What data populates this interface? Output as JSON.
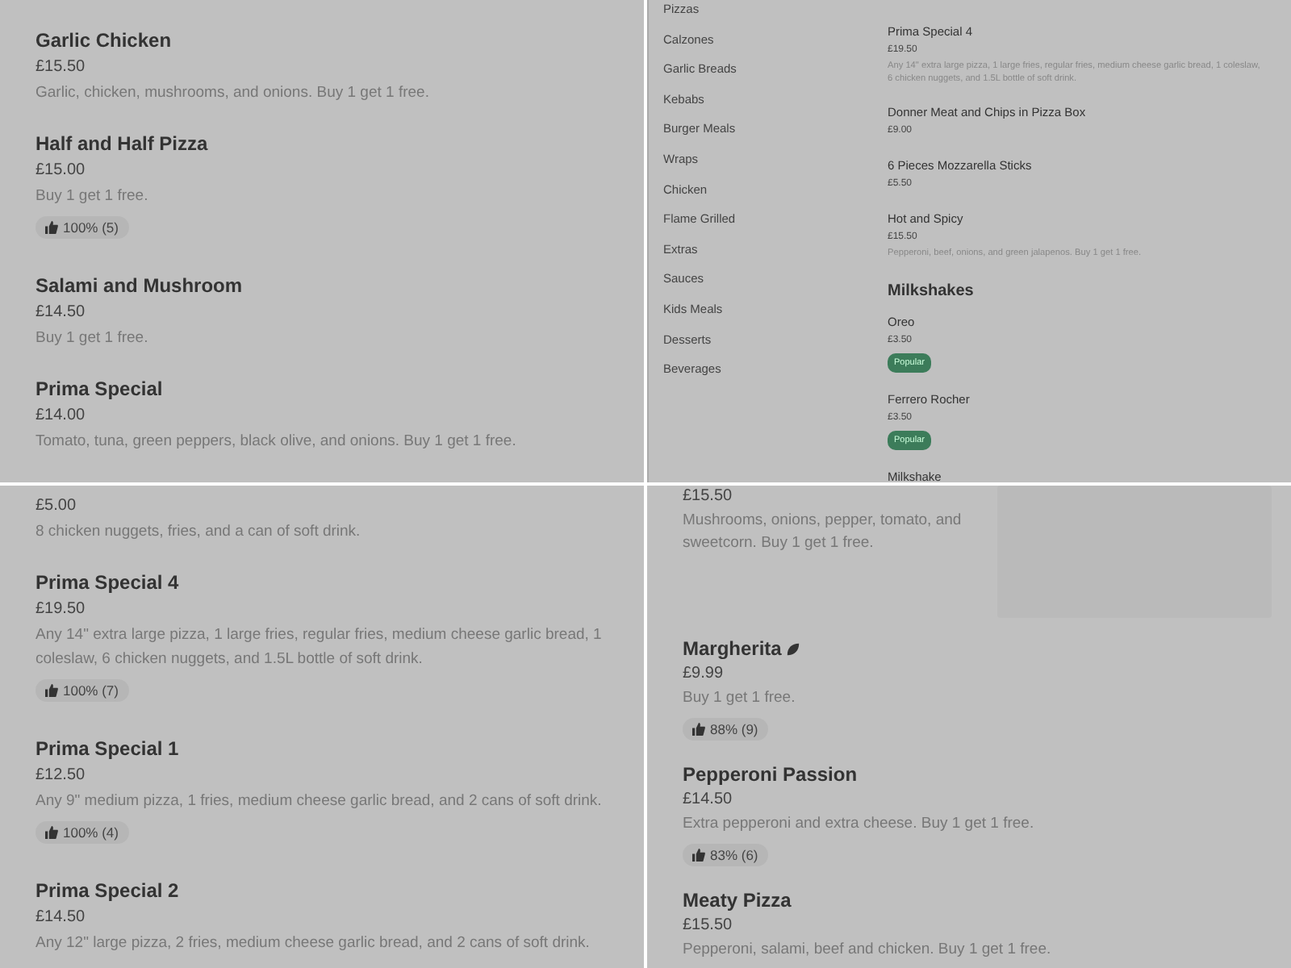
{
  "panels": [
    {
      "kind": "list",
      "items": [
        {
          "name": "Garlic Chicken",
          "price": "£15.50",
          "description": "Garlic, chicken, mushrooms, and onions. Buy 1 get 1 free."
        },
        {
          "name": "Half and Half Pizza",
          "price": "£15.00",
          "description": "Buy 1 get 1 free.",
          "rating": "100% (5)"
        },
        {
          "name": "Salami and Mushroom",
          "price": "£14.50",
          "description": "Buy 1 get 1 free."
        },
        {
          "name": "Prima Special",
          "price": "£14.00",
          "description": "Tomato, tuna, green peppers, black olive, and onions. Buy 1 get 1 free."
        }
      ]
    },
    {
      "kind": "menu",
      "categories": [
        "Pizzas",
        "Calzones",
        "Garlic Breads",
        "Kebabs",
        "Burger Meals",
        "Wraps",
        "Chicken",
        "Flame Grilled",
        "Extras",
        "Sauces",
        "Kids Meals",
        "Desserts",
        "Beverages"
      ],
      "sections": [
        {
          "items": [
            {
              "name": "Prima Special 4",
              "price": "£19.50",
              "description": "Any 14\" extra large pizza, 1 large fries, regular fries, medium cheese garlic bread, 1 coleslaw, 6 chicken nuggets, and 1.5L bottle of soft drink."
            },
            {
              "name": "Donner Meat and Chips in Pizza Box",
              "price": "£9.00"
            },
            {
              "name": "6 Pieces Mozzarella Sticks",
              "price": "£5.50"
            },
            {
              "name": "Hot and Spicy",
              "price": "£15.50",
              "description": "Pepperoni, beef, onions, and green jalapenos. Buy 1 get 1 free."
            }
          ]
        },
        {
          "title": "Milkshakes",
          "items": [
            {
              "name": "Oreo",
              "price": "£3.50",
              "badge": "Popular"
            },
            {
              "name": "Ferrero Rocher",
              "price": "£3.50",
              "badge": "Popular"
            },
            {
              "name": "Milkshake"
            }
          ]
        }
      ]
    },
    {
      "kind": "list",
      "items": [
        {
          "price": "£5.00",
          "description": "8 chicken nuggets, fries, and a can of soft drink."
        },
        {
          "name": "Prima Special 4",
          "price": "£19.50",
          "description": "Any 14\" extra large pizza, 1 large fries, regular fries, medium cheese garlic bread, 1 coleslaw, 6 chicken nuggets, and 1.5L bottle of soft drink.",
          "rating": "100% (7)"
        },
        {
          "name": "Prima Special 1",
          "price": "£12.50",
          "description": "Any 9\" medium pizza, 1 fries, medium cheese garlic bread, and 2 cans of soft drink.",
          "rating": "100% (4)"
        },
        {
          "name": "Prima Special 2",
          "price": "£14.50",
          "description": "Any 12\" large pizza, 2 fries, medium cheese garlic bread, and 2 cans of soft drink."
        }
      ]
    },
    {
      "kind": "list",
      "items": [
        {
          "price": "£15.50",
          "description": "Mushrooms, onions, pepper, tomato, and sweetcorn. Buy 1 get 1 free.",
          "image": true
        },
        {
          "name": "Margherita",
          "vegetarian": true,
          "price": "£9.99",
          "description": "Buy 1 get 1 free.",
          "rating": "88% (9)"
        },
        {
          "name": "Pepperoni Passion",
          "price": "£14.50",
          "description": "Extra pepperoni and extra cheese. Buy 1 get 1 free.",
          "rating": "83% (6)"
        },
        {
          "name": "Meaty Pizza",
          "price": "£15.50",
          "description": "Pepperoni, salami, beef and chicken. Buy 1 get 1 free."
        }
      ]
    }
  ]
}
